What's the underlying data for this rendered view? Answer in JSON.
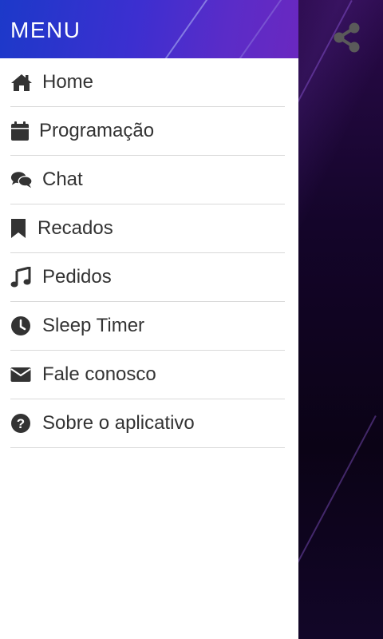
{
  "header": {
    "title": "MENU"
  },
  "menu": {
    "items": [
      {
        "label": "Home",
        "icon": "home-icon"
      },
      {
        "label": "Programação",
        "icon": "calendar-icon"
      },
      {
        "label": "Chat",
        "icon": "chat-icon"
      },
      {
        "label": "Recados",
        "icon": "bookmark-icon"
      },
      {
        "label": "Pedidos",
        "icon": "music-note-icon"
      },
      {
        "label": "Sleep Timer",
        "icon": "clock-icon"
      },
      {
        "label": "Fale conosco",
        "icon": "envelope-icon"
      },
      {
        "label": "Sobre o aplicativo",
        "icon": "question-circle-icon"
      }
    ]
  },
  "actions": {
    "share": "share-icon"
  },
  "colors": {
    "header_start": "#1c39c9",
    "header_end": "#6a28c0",
    "icon": "#333333",
    "share_icon": "#5a5a5a",
    "divider": "#d9d9d9"
  }
}
